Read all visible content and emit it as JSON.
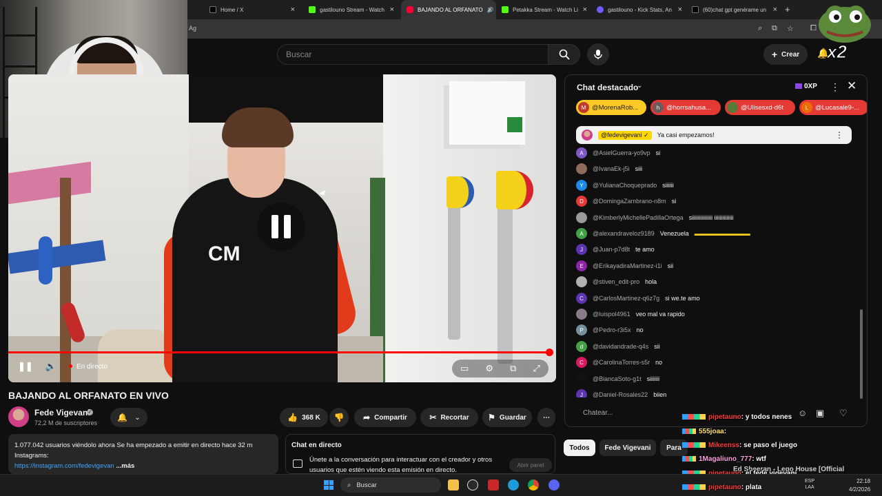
{
  "browser": {
    "tabs": [
      {
        "label": "Home / X",
        "favicon_color": "#000000",
        "active": false
      },
      {
        "label": "gastilouno Stream - Watch",
        "favicon_color": "#53fc18",
        "active": false
      },
      {
        "label": "BAJANDO AL ORFANATO",
        "favicon_color": "#ff0033",
        "active": true
      },
      {
        "label": "Petakka Stream - Watch Li",
        "favicon_color": "#53fc18",
        "active": false
      },
      {
        "label": "gastilouno - Kick Stats, An",
        "favicon_color": "#6e5cff",
        "active": false
      },
      {
        "label": "(60)chat gpt genérame un",
        "favicon_color": "#000000",
        "active": false
      }
    ],
    "new_tab": "+",
    "address_fragment": "Ag"
  },
  "header": {
    "search_placeholder": "Buscar",
    "create_label": "Crear"
  },
  "overlay": {
    "multiplier": "x2"
  },
  "video": {
    "title": "BAJANDO AL ORFANATO EN VIVO",
    "live_label": "En directo",
    "progress": 1.0,
    "board_letters": "CM"
  },
  "channel": {
    "name": "Fede Vigevani",
    "verified": "✓",
    "subscribers": "72,2 M de suscriptores"
  },
  "actions": {
    "likes": "368 K",
    "share": "Compartir",
    "clip": "Recortar",
    "save": "Guardar",
    "more": "⋯"
  },
  "description": {
    "line1": "1.077.042 usuarios viéndolo ahora  Se ha empezado a emitir en directo hace 32 m",
    "line2": "Instagrams:",
    "link": "https://instagram.com/fedevigevan",
    "more": "...más"
  },
  "chat_card": {
    "title": "Chat en directo",
    "text": "Únete a la conversación para interactuar con el creador y otros usuarios que estén viendo esta emisión en directo.",
    "button": "Abrir panel"
  },
  "chat": {
    "title": "Chat destacado",
    "xp": "0XP",
    "donors": [
      {
        "name": "@MorenaRob...",
        "initial": "M",
        "color": "#ffca28",
        "avatar_color": "#c0392b"
      },
      {
        "name": "@horrsahusa...",
        "initial": "h",
        "color": "#e53935",
        "avatar_color": "#6d5c5c"
      },
      {
        "name": "@Ulisesxd-d6t",
        "initial": "",
        "color": "#e53935",
        "avatar_color": "#5a7a3a"
      },
      {
        "name": "@Lucasale9-...",
        "initial": "L",
        "color": "#e53935",
        "avatar_color": "#ef6c00"
      }
    ],
    "pinned": {
      "name": "@fedevigevani ✓",
      "text": "Ya casi empezamos!"
    },
    "messages": [
      {
        "initial": "A",
        "avatar_color": "#7e57c2",
        "name": "@AsielGuerra-yo9vp",
        "text": "si"
      },
      {
        "initial": "",
        "avatar_color": "#8e6b5a",
        "name": "@IvanaEk-j5i",
        "text": "siii"
      },
      {
        "initial": "Y",
        "avatar_color": "#1e88e5",
        "name": "@YulianaChoqueprado",
        "text": "siiiiii"
      },
      {
        "initial": "D",
        "avatar_color": "#e53935",
        "name": "@DomingaZambrano-n8m",
        "text": "si"
      },
      {
        "initial": "",
        "avatar_color": "#9a9a9a",
        "name": "@KimberlyMichellePadillaOrtega",
        "text": "siiiiiiiiiiiiiii iiiiiiiiiiiiii"
      },
      {
        "initial": "A",
        "avatar_color": "#43a047",
        "name": "@alexandraveloz9189",
        "text": "Venezuela",
        "flags": "▬▬▬▬▬▬▬▬▬▬"
      },
      {
        "initial": "J",
        "avatar_color": "#5e35b1",
        "name": "@Juan-p7d8t",
        "text": "te amo"
      },
      {
        "initial": "E",
        "avatar_color": "#8e24aa",
        "name": "@ErikayadiraMartinez-i1i",
        "text": "sii"
      },
      {
        "initial": "",
        "avatar_color": "#b0b0b0",
        "name": "@stiven_edit-pro",
        "text": "hola"
      },
      {
        "initial": "C",
        "avatar_color": "#5e35b1",
        "name": "@CarlosMartinez-q6z7g",
        "text": "si we.te amo"
      },
      {
        "initial": "",
        "avatar_color": "#8a7a8a",
        "name": "@luispol4961",
        "text": "veo mal va rapido"
      },
      {
        "initial": "P",
        "avatar_color": "#78909c",
        "name": "@Pedro-r3i5x",
        "text": "no"
      },
      {
        "initial": "d",
        "avatar_color": "#43a047",
        "name": "@davidandrade-q4s",
        "text": "sii"
      },
      {
        "initial": "C",
        "avatar_color": "#d81b60",
        "name": "@CarolinaTorres-s5r",
        "text": "no"
      },
      {
        "initial": "",
        "avatar_color": "#111111",
        "name": "@BiancaSoto-g1t",
        "text": "siiiiiii"
      },
      {
        "initial": "J",
        "avatar_color": "#5e35b1",
        "name": "@Daniel-Rosales22",
        "text": "biien"
      }
    ],
    "input_placeholder": "Chatear..."
  },
  "filters": [
    {
      "label": "Todos",
      "active": true
    },
    {
      "label": "Fede Vigevani",
      "active": false
    },
    {
      "label": "Para",
      "active": false
    }
  ],
  "stream_overlay": [
    {
      "user": "pipetauno",
      "user_color": "red",
      "text": ": y todos nenes"
    },
    {
      "user": "555joaa",
      "user_color": "yellow",
      "text": ":"
    },
    {
      "user": "Mikeenss",
      "user_color": "red",
      "text": ": se paso el juego"
    },
    {
      "user": "1Magaliuno_777",
      "user_color": "pink",
      "text": ": wtf"
    },
    {
      "user": "pipetauno",
      "user_color": "red",
      "text": ": el fede vigevani"
    },
    {
      "user": "pipetauno",
      "user_color": "red",
      "text": ": plata"
    }
  ],
  "media": {
    "now_playing": "Ed Sheeran - Lego House [Official"
  },
  "taskbar": {
    "search_label": "Buscar",
    "lang": "ESP",
    "lang2": "LAA",
    "time": "22:18",
    "date": "4/2/2026"
  }
}
